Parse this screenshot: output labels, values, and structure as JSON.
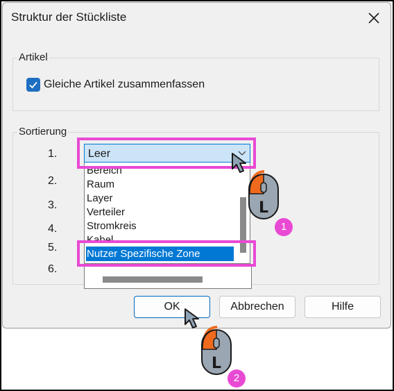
{
  "dialog": {
    "title": "Struktur der Stückliste",
    "close_icon": "close-icon"
  },
  "artikel": {
    "group_label": "Artikel",
    "checkbox_label": "Gleiche Artikel zusammenfassen",
    "checkbox_checked": true
  },
  "sortierung": {
    "group_label": "Sortierung",
    "rows": [
      "1.",
      "2.",
      "3.",
      "4.",
      "5.",
      "6."
    ],
    "combo_value": "Leer",
    "options": [
      "Bereich",
      "Raum",
      "Layer",
      "Verteiler",
      "Stromkreis",
      "Kabel"
    ],
    "highlighted_option": "Nutzer Spezifische Zone"
  },
  "buttons": {
    "ok": "OK",
    "cancel": "Abbrechen",
    "help": "Hilfe"
  },
  "annotations": {
    "step1": "1",
    "step2": "2",
    "mouse_button": "L",
    "accent_color": "#e84ad4"
  }
}
